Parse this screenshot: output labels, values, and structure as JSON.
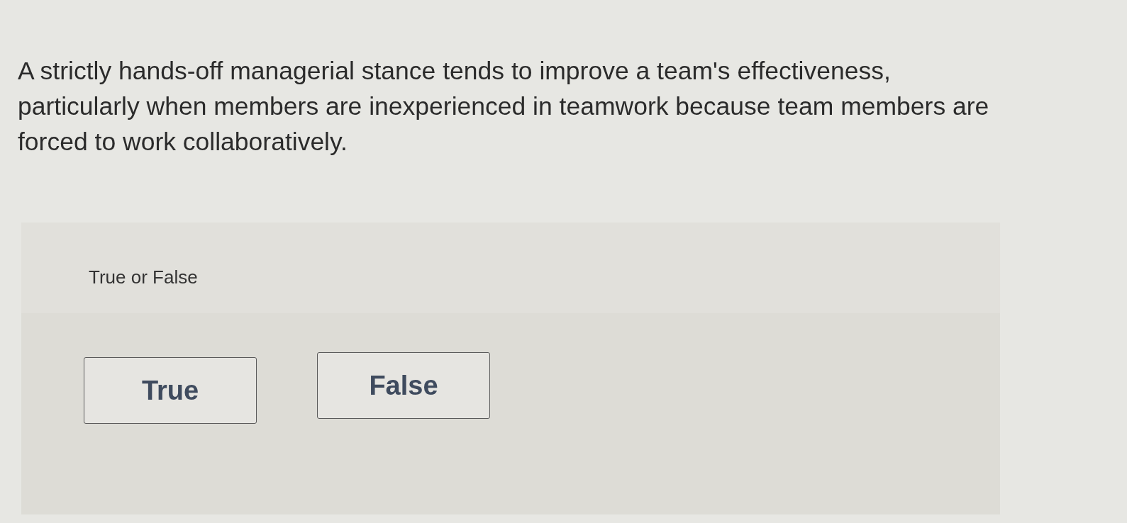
{
  "question": {
    "text": "A strictly hands-off managerial stance tends to improve a team's effectiveness, particularly when members are inexperienced in teamwork because team members are forced to work collaboratively."
  },
  "answer_panel": {
    "prompt": "True or False",
    "options": [
      {
        "label": "True",
        "selected": false
      },
      {
        "label": "False",
        "selected": false
      }
    ]
  }
}
